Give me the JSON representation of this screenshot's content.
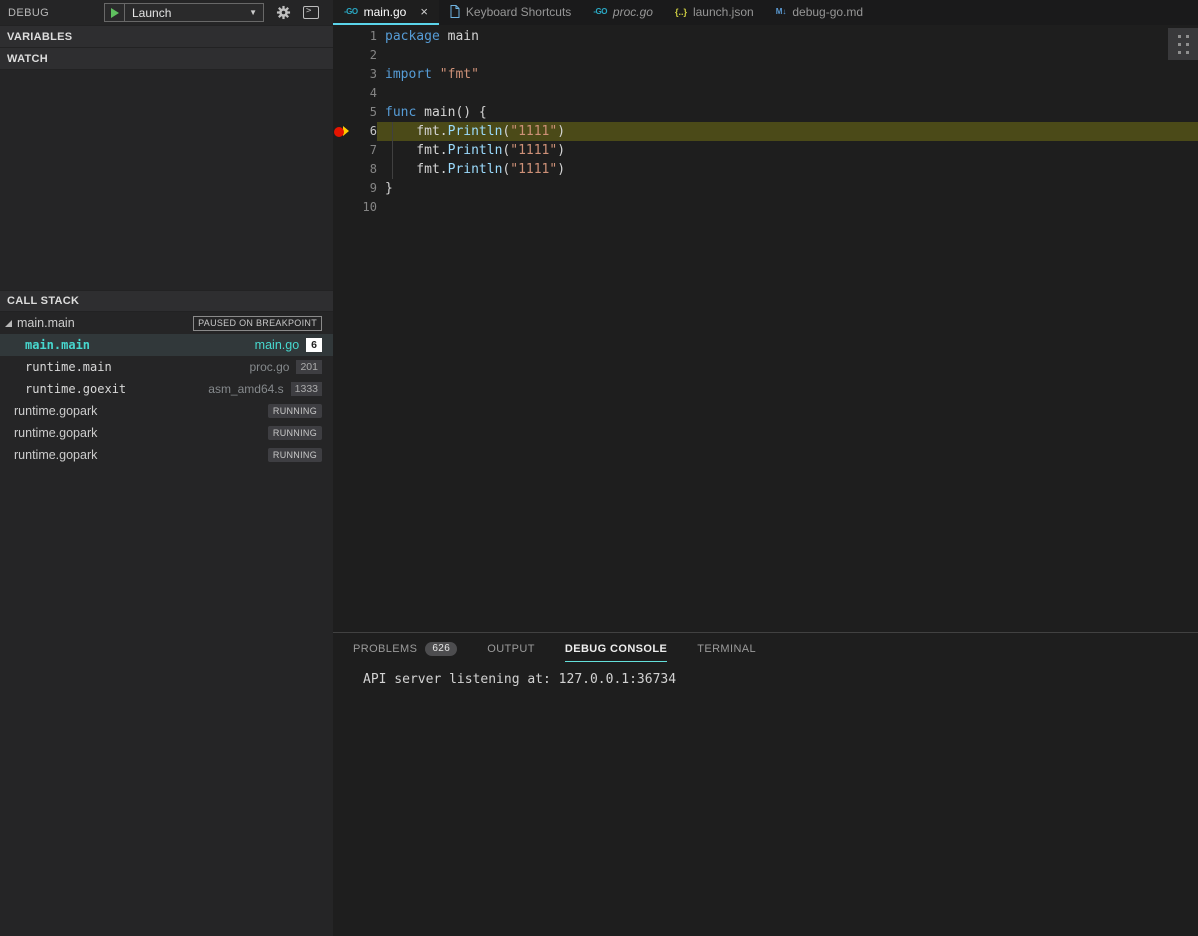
{
  "colors": {
    "keyword": "#569cd6",
    "plain": "#d4d4d4",
    "string": "#ce9178",
    "function": "#9cdcfe",
    "tab_accent": "#5bd4ea",
    "current_line_bg": "#4b4a18",
    "stack_cyan": "#47d8cf",
    "breakpoint_red": "#e51400",
    "pointer_yellow": "#ffcc00",
    "play_green": "#5fc15f",
    "console_underline": "#64e0db"
  },
  "glyphs": {
    "go": "-GO",
    "braces": "{..}",
    "markdown": "M↓",
    "chevron_down": "▼",
    "close": "×",
    "console_prompt": ">"
  },
  "debug_sidebar": {
    "title": "DEBUG",
    "launch_label": "Launch",
    "sections": [
      {
        "id": "variables",
        "label": "VARIABLES"
      },
      {
        "id": "watch",
        "label": "WATCH"
      },
      {
        "id": "call_stack",
        "label": "CALL STACK"
      }
    ],
    "call_stack": {
      "rows": [
        {
          "type": "thread",
          "name": "main.main",
          "badge": "PAUSED ON BREAKPOINT",
          "badge_style": "outline",
          "expanded": true
        },
        {
          "type": "frame",
          "name": "main.main",
          "file": "main.go",
          "line": "6",
          "selected": true
        },
        {
          "type": "frame",
          "name": "runtime.main",
          "file": "proc.go",
          "line": "201"
        },
        {
          "type": "frame",
          "name": "runtime.goexit",
          "file": "asm_amd64.s",
          "line": "1333"
        },
        {
          "type": "thread",
          "name": "runtime.gopark",
          "badge": "RUNNING",
          "badge_style": "solid"
        },
        {
          "type": "thread",
          "name": "runtime.gopark",
          "badge": "RUNNING",
          "badge_style": "solid"
        },
        {
          "type": "thread",
          "name": "runtime.gopark",
          "badge": "RUNNING",
          "badge_style": "solid"
        }
      ]
    }
  },
  "editor_tabs": [
    {
      "label": "main.go",
      "icon": "go",
      "active": true,
      "close": true
    },
    {
      "label": "Keyboard Shortcuts",
      "icon": "file"
    },
    {
      "label": "proc.go",
      "icon": "go",
      "italic": true
    },
    {
      "label": "launch.json",
      "icon": "braces"
    },
    {
      "label": "debug-go.md",
      "icon": "markdown"
    }
  ],
  "editor": {
    "lines": [
      {
        "num": "1",
        "tokens": [
          [
            "keyword",
            "package"
          ],
          [
            "plain",
            " main"
          ]
        ]
      },
      {
        "num": "2",
        "tokens": []
      },
      {
        "num": "3",
        "tokens": [
          [
            "keyword",
            "import"
          ],
          [
            "plain",
            " "
          ],
          [
            "string",
            "\"fmt\""
          ]
        ]
      },
      {
        "num": "4",
        "tokens": []
      },
      {
        "num": "5",
        "tokens": [
          [
            "keyword",
            "func"
          ],
          [
            "plain",
            " main() {"
          ]
        ]
      },
      {
        "num": "6",
        "current": true,
        "breakpoint": true,
        "guide": true,
        "tokens": [
          [
            "plain",
            "    fmt."
          ],
          [
            "function",
            "Println"
          ],
          [
            "plain",
            "("
          ],
          [
            "string",
            "\"1111\""
          ],
          [
            "plain",
            ")"
          ]
        ]
      },
      {
        "num": "7",
        "guide": true,
        "tokens": [
          [
            "plain",
            "    fmt."
          ],
          [
            "function",
            "Println"
          ],
          [
            "plain",
            "("
          ],
          [
            "string",
            "\"1111\""
          ],
          [
            "plain",
            ")"
          ]
        ]
      },
      {
        "num": "8",
        "guide": true,
        "tokens": [
          [
            "plain",
            "    fmt."
          ],
          [
            "function",
            "Println"
          ],
          [
            "plain",
            "("
          ],
          [
            "string",
            "\"1111\""
          ],
          [
            "plain",
            ")"
          ]
        ]
      },
      {
        "num": "9",
        "tokens": [
          [
            "plain",
            "}"
          ]
        ]
      },
      {
        "num": "10",
        "tokens": []
      }
    ]
  },
  "panel": {
    "tabs": [
      {
        "label": "PROBLEMS",
        "badge": "626"
      },
      {
        "label": "OUTPUT"
      },
      {
        "label": "DEBUG CONSOLE",
        "active": true
      },
      {
        "label": "TERMINAL"
      }
    ],
    "console_lines": [
      "API server listening at: 127.0.0.1:36734"
    ]
  }
}
